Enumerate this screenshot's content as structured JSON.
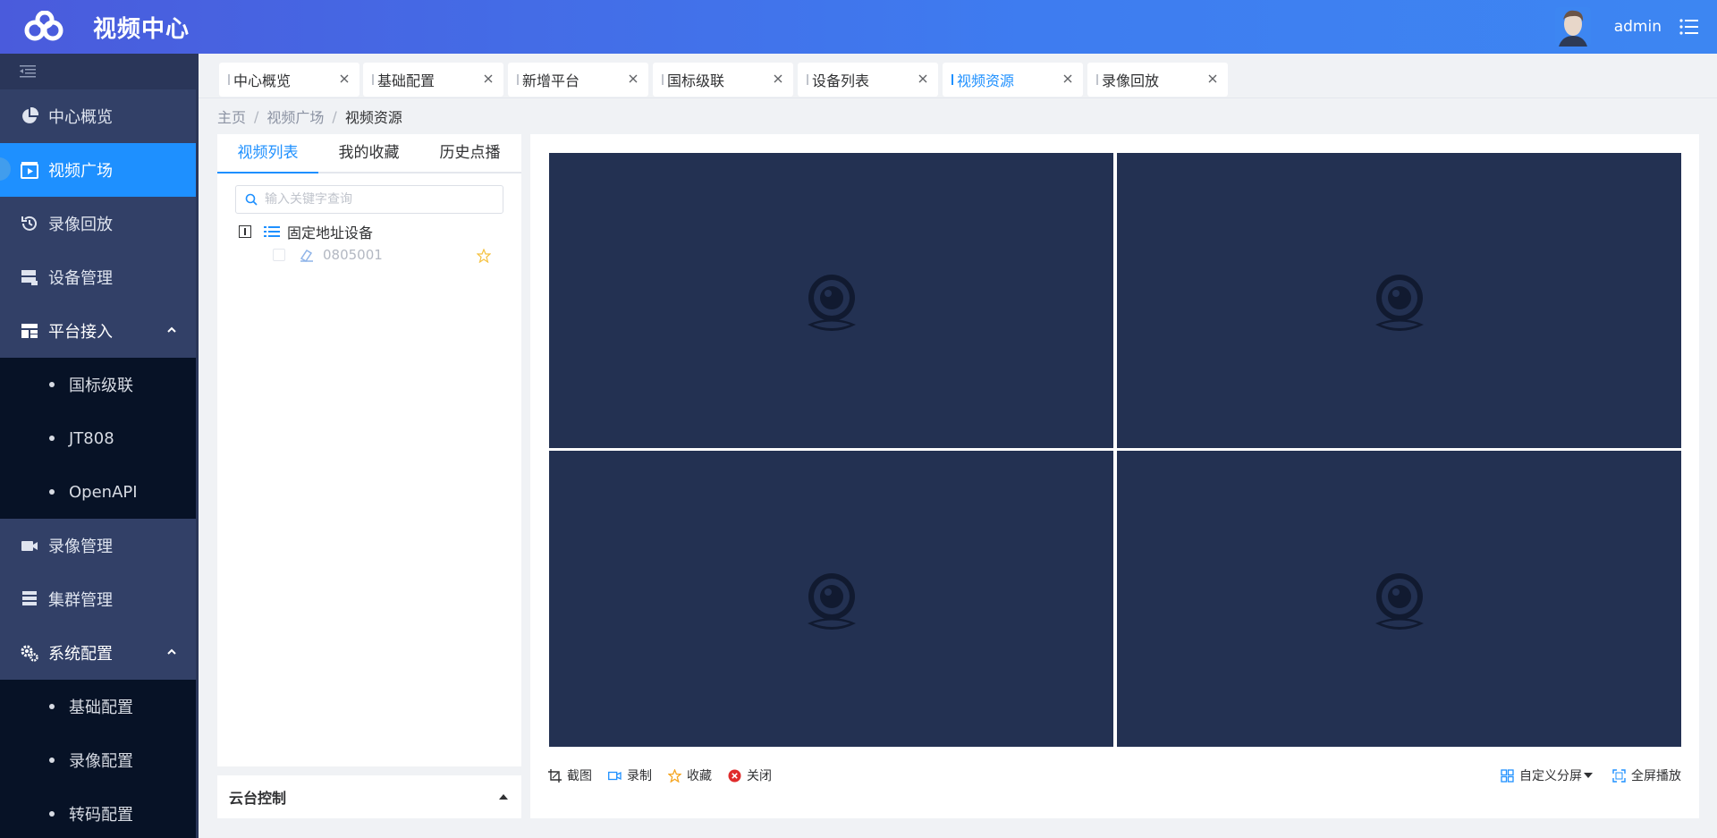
{
  "header": {
    "title": "视频中心",
    "username": "admin"
  },
  "sidebar": {
    "items": [
      {
        "label": "中心概览"
      },
      {
        "label": "视频广场"
      },
      {
        "label": "录像回放"
      },
      {
        "label": "设备管理"
      },
      {
        "label": "平台接入"
      },
      {
        "label": "录像管理"
      },
      {
        "label": "集群管理"
      },
      {
        "label": "系统配置"
      }
    ],
    "platform_sub": [
      "国标级联",
      "JT808",
      "OpenAPI"
    ],
    "config_sub": [
      "基础配置",
      "录像配置",
      "转码配置"
    ]
  },
  "tabs": [
    {
      "label": "中心概览"
    },
    {
      "label": "基础配置"
    },
    {
      "label": "新增平台"
    },
    {
      "label": "国标级联"
    },
    {
      "label": "设备列表"
    },
    {
      "label": "视频资源"
    },
    {
      "label": "录像回放"
    }
  ],
  "breadcrumb": {
    "home": "主页",
    "parent": "视频广场",
    "current": "视频资源",
    "sep": "/"
  },
  "left_panel": {
    "tabs": [
      "视频列表",
      "我的收藏",
      "历史点播"
    ],
    "search_placeholder": "输入关键字查询",
    "tree_root": "固定地址设备",
    "tree_child": "0805001",
    "ptz_label": "云台控制"
  },
  "toolbar": {
    "snapshot": "截图",
    "record": "录制",
    "favorite": "收藏",
    "close": "关闭",
    "split": "自定义分屏",
    "fullscreen": "全屏播放"
  },
  "colors": {
    "header_start": "#4a5bdc",
    "header_end": "#3d86f2",
    "sidebar": "#324067",
    "active": "#1e90ff",
    "video_cell": "#233152"
  }
}
